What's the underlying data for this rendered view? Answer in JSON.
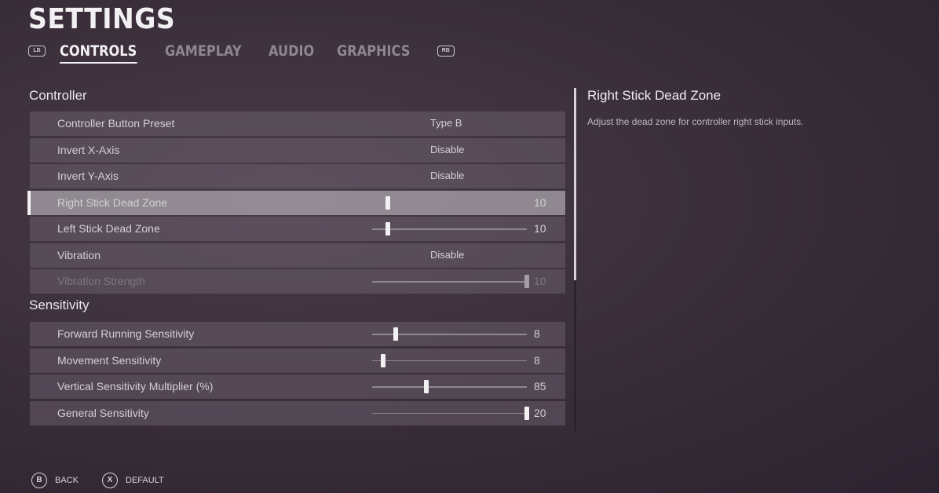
{
  "page": {
    "title": "SETTINGS"
  },
  "tabs": {
    "left_bumper": "LB",
    "right_bumper": "RB",
    "items": [
      "CONTROLS",
      "GAMEPLAY",
      "AUDIO",
      "GRAPHICS"
    ],
    "active": "CONTROLS"
  },
  "controller": {
    "title": "Controller",
    "rows": [
      {
        "label": "Controller Button Preset",
        "value": "Type B"
      },
      {
        "label": "Invert X-Axis",
        "value": "Disable"
      },
      {
        "label": "Invert Y-Axis",
        "value": "Disable"
      },
      {
        "label": "Right Stick Dead Zone",
        "slider_value": "10",
        "fraction": 0.1,
        "selected": true
      },
      {
        "label": "Left Stick Dead Zone",
        "slider_value": "10",
        "fraction": 0.1
      },
      {
        "label": "Vibration",
        "value": "Disable"
      },
      {
        "label": "Vibration Strength",
        "slider_value": "10",
        "fraction": 1.0,
        "disabled": true
      }
    ]
  },
  "sensitivity": {
    "title": "Sensitivity",
    "rows": [
      {
        "label": "Forward Running Sensitivity",
        "slider_value": "8",
        "fraction": 0.15
      },
      {
        "label": "Movement Sensitivity",
        "slider_value": "8",
        "fraction": 0.07
      },
      {
        "label": "Vertical Sensitivity Multiplier (%)",
        "slider_value": "85",
        "fraction": 0.35
      },
      {
        "label": "General Sensitivity",
        "slider_value": "20",
        "fraction": 1.0
      }
    ]
  },
  "info": {
    "title": "Right Stick Dead Zone",
    "description": "Adjust the dead zone for controller right stick inputs."
  },
  "footer": {
    "back_button": "B",
    "back_label": "BACK",
    "default_button": "X",
    "default_label": "DEFAULT"
  },
  "colors": {
    "accent": "#f2f0f2",
    "row_bg": "#5a4f5c",
    "selected_bg": "#9c949e"
  }
}
